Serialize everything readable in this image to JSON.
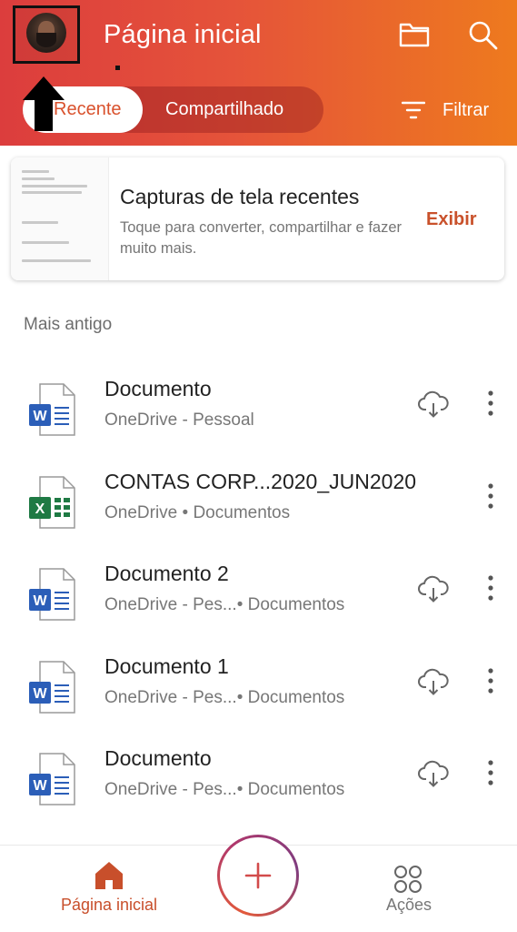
{
  "header": {
    "title": "Página inicial",
    "tabs": [
      {
        "label": "Recente",
        "active": true
      },
      {
        "label": "Compartilhado",
        "active": false
      }
    ],
    "filter_label": "Filtrar"
  },
  "card": {
    "title": "Capturas de tela recentes",
    "description": "Toque para converter, compartilhar e fazer muito mais.",
    "action": "Exibir"
  },
  "section": {
    "label": "Mais antigo"
  },
  "files": [
    {
      "name": "Documento",
      "location": "OneDrive - Pessoal",
      "type": "word",
      "cloud": true
    },
    {
      "name": "CONTAS CORP...2020_JUN2020",
      "location": "OneDrive • Documentos",
      "type": "excel",
      "cloud": false
    },
    {
      "name": "Documento 2",
      "location": "OneDrive - Pes...• Documentos",
      "type": "word",
      "cloud": true
    },
    {
      "name": "Documento 1",
      "location": "OneDrive - Pes...• Documentos",
      "type": "word",
      "cloud": true
    },
    {
      "name": "Documento",
      "location": "OneDrive - Pes...• Documentos",
      "type": "word",
      "cloud": true
    }
  ],
  "bottom_nav": {
    "home_label": "Página inicial",
    "actions_label": "Ações"
  },
  "colors": {
    "header_start": "#dc3d3d",
    "header_end": "#ee7a1e",
    "accent": "#c9512b",
    "word": "#2b5eb8",
    "excel": "#1f7a44"
  },
  "icons": {
    "folder": "folder-icon",
    "search": "search-icon",
    "filter": "filter-icon",
    "cloud": "cloud-download-icon",
    "more": "more-vertical-icon",
    "home": "home-icon",
    "add": "plus-icon",
    "actions": "actions-grid-icon"
  }
}
